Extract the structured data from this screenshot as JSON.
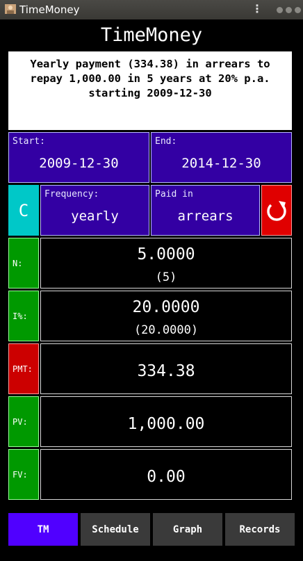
{
  "window": {
    "title": "TimeMoney"
  },
  "app": {
    "title": "TimeMoney"
  },
  "description": {
    "line1": "Yearly payment (334.38) in arrears to",
    "line2": "repay 1,000.00 in 5 years at 20% p.a.",
    "line3": "starting 2009-12-30"
  },
  "dates": {
    "start_label": "Start:",
    "start_value": "2009-12-30",
    "end_label": "End:",
    "end_value": "2014-12-30"
  },
  "options": {
    "clear_label": "C",
    "frequency_label": "Frequency:",
    "frequency_value": "yearly",
    "paid_in_label": "Paid in",
    "paid_in_value": "arrears"
  },
  "fields": {
    "n": {
      "label": "N:",
      "value": "5.0000",
      "detail": "(5)"
    },
    "i": {
      "label": "I%:",
      "value": "20.0000",
      "detail": "(20.0000)"
    },
    "pmt": {
      "label": "PMT:",
      "value": "334.38"
    },
    "pv": {
      "label": "PV:",
      "value": "1,000.00"
    },
    "fv": {
      "label": "FV:",
      "value": "0.00"
    }
  },
  "tabs": [
    {
      "label": "TM",
      "active": true
    },
    {
      "label": "Schedule",
      "active": false
    },
    {
      "label": "Graph",
      "active": false
    },
    {
      "label": "Records",
      "active": false
    }
  ],
  "colors": {
    "input_bg": "#3300a3",
    "computed_field": "#cc0000",
    "known_field": "#009900",
    "active_tab": "#5000ff"
  },
  "icons": [
    "app-icon",
    "menu-kebab-icon",
    "reset-icon"
  ]
}
